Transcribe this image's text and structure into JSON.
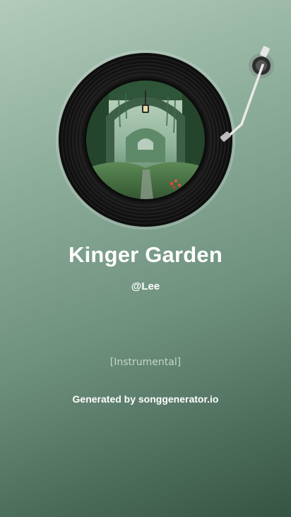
{
  "song": {
    "title": "Kinger Garden",
    "artist": "@Lee",
    "lyrics": "[Instrumental]"
  },
  "footer": {
    "credit": "Generated by songgenerator.io"
  },
  "artwork": {
    "icon": "vinyl-record-with-garden-artwork",
    "colors": [
      "#1f4a35",
      "#4d7a4a",
      "#9ec295"
    ]
  },
  "theme": {
    "background_start": "#b2cbbb",
    "background_end": "#365443",
    "text_color": "#ffffff"
  }
}
